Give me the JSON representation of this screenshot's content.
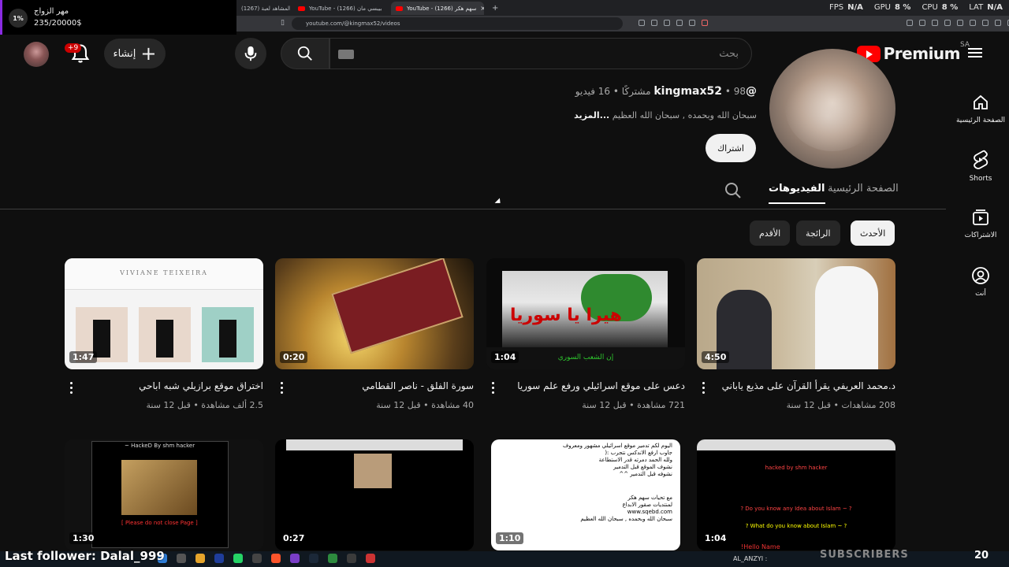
{
  "browser": {
    "tabs": [
      {
        "label": "(1267) جميع المشاهد لعبة"
      },
      {
        "label": "YouTube - (1266) بيبسي مان"
      },
      {
        "label": "YouTube - (1266) سهم هكر"
      }
    ],
    "url": "youtube.com/@kingmax52/videos",
    "stats": {
      "fps_label": "FPS",
      "fps_value": "N/A",
      "gpu_label": "GPU",
      "gpu_value": "8 %",
      "cpu_label": "CPU",
      "cpu_value": "8 %",
      "lat_label": "LAT",
      "lat_value": "N/A"
    }
  },
  "overlay": {
    "donation_pct": "1%",
    "donation_title": "مهر الزواج",
    "donation_progress": "235/20000$",
    "last_follower": "Last follower: Dalal_999",
    "subscribers": "SUBSCRIBERS",
    "count": "20",
    "chat_name": "AL_ANZYI :",
    "chat_red": "!Hello Name"
  },
  "masthead": {
    "logo_text": "Premium",
    "country": "SA",
    "search_placeholder": "بحث",
    "create_label": "إنشاء",
    "notif_badge": "+9"
  },
  "sidebar": {
    "items": [
      {
        "label": "الصفحة الرئيسية",
        "icon": "home-icon"
      },
      {
        "label": "Shorts",
        "icon": "shorts-icon"
      },
      {
        "label": "الاشتراكات",
        "icon": "subscriptions-icon"
      },
      {
        "label": "أنت",
        "icon": "you-icon"
      }
    ]
  },
  "channel": {
    "handle": "@kingmax52",
    "stats": "• 98 مشتركًا • 16 فيديو",
    "description": "سبحان الله وبحمده , سبحان الله العظيم",
    "more": "...المزيد",
    "subscribe": "اشتراك",
    "tabs": {
      "home": "الصفحة الرئيسية",
      "videos": "الفيديوهات"
    },
    "chips": {
      "latest": "الأحدث",
      "popular": "الرائجة",
      "oldest": "الأقدم"
    }
  },
  "videos": [
    {
      "title": "د.محمد العريفي يقرأ القرآن على مذيع ياباني",
      "meta": "208 مشاهدات • قبل 12 سنة",
      "duration": "4:50"
    },
    {
      "title": "دعس على موقع اسرائيلي ورفع علم سوريا",
      "meta": "721 مشاهدة • قبل 12 سنة",
      "duration": "1:04"
    },
    {
      "title": "سورة الفلق - ناصر القطامي",
      "meta": "40 مشاهدة • قبل 12 سنة",
      "duration": "0:20"
    },
    {
      "title": "اختراق موقع برازيلي شبه اباحي",
      "meta": "2.5 ألف مشاهدة • قبل 12 سنة",
      "duration": "1:47"
    },
    {
      "duration": "1:04"
    },
    {
      "duration": "1:10"
    },
    {
      "duration": "0:27"
    },
    {
      "duration": "1:30"
    }
  ],
  "thumb_text": {
    "web_brand": "VIVIANE TEIXEIRA",
    "syria_big": "هيرا يا سوريا",
    "syria_bottom": "إن الشعب السوري",
    "hack1_title": "~ HackeD By shm hacker",
    "hack1_red": "[ Please do not close Page ]",
    "hack3_title": "hacked by shm hacker",
    "hack3_q1": "? Do you know any Idea about Islam ~ ?",
    "hack3_q2": "? What do you know about Islam ~ ?",
    "text_l1": "اليوم لكم تدمير موقع اسرائيلي مشهور ومعروف",
    "text_l2": "جاوب ارفع الاندكس نتجرب :(",
    "text_l3": "ولله الحمد دمرته قدر الاستطاعة",
    "text_l4": "نشوف الموقع قبل التدمير",
    "text_l5": "نشوفه قبل التدمير ^^",
    "text_l6": "مع تحيات سهم هكر",
    "text_l7": "لمنتديات صقور الابداع",
    "text_l8": "www.sqebd.com",
    "text_l9": "سبحان الله وبحمده , سبحان الله العظيم"
  }
}
